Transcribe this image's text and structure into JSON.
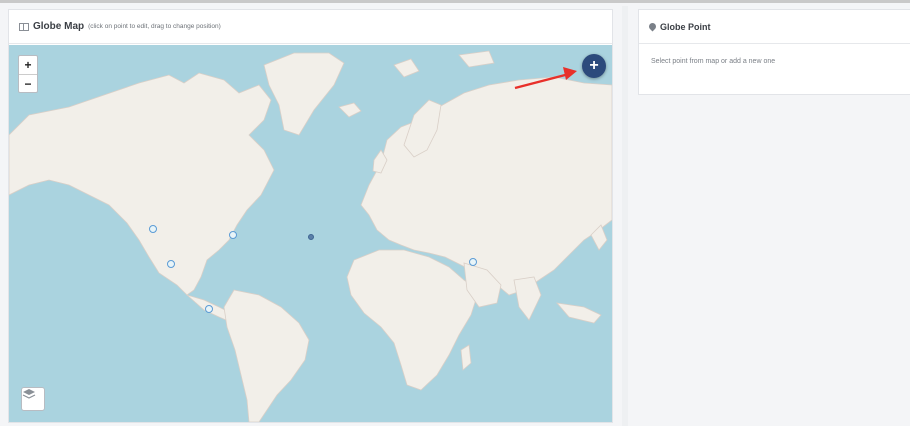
{
  "map_panel": {
    "title": "Globe Map",
    "hint": "(click on point to edit, drag to change position)",
    "zoom_in": "+",
    "zoom_out": "−",
    "add_label": "+"
  },
  "side_panel": {
    "title": "Globe Point",
    "body": "Select point from map or add a new one"
  },
  "colors": {
    "ocean": "#aad3df",
    "land": "#f2efe9",
    "accent_button": "#2c4a7c",
    "marker_border": "#5b9bd5",
    "annotation_arrow": "#e8302a"
  }
}
